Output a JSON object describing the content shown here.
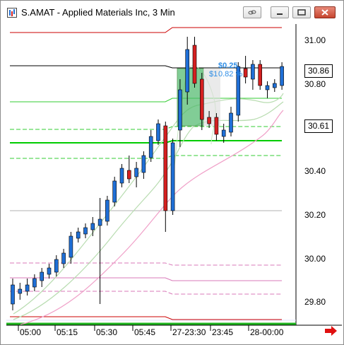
{
  "window": {
    "title": "S.AMAT - Applied Materials Inc, 3 Min",
    "buttons": [
      "link-icon",
      "minimize-icon",
      "restore-icon",
      "close-icon"
    ]
  },
  "price_axis": {
    "ticks": [
      "31.00",
      "30.80",
      "30.40",
      "30.20",
      "30.00",
      "29.80"
    ],
    "last_price": "30.86",
    "marker_price": "30.61"
  },
  "time_axis": {
    "ticks": [
      "05:00",
      "05:15",
      "05:30",
      "05:45",
      "27-23:30",
      "23:45",
      "28-00:00"
    ]
  },
  "annotation": {
    "gain": "$0.25",
    "gain_pct": "0.82 %",
    "prefix": "$1"
  },
  "colors": {
    "up": "#1f6fd6",
    "down": "#d42020",
    "green_line": "#33cc33",
    "pink_line": "#f0a0c8",
    "red_line": "#cc0000"
  },
  "chart_data": {
    "type": "candlestick",
    "ylim": [
      29.7,
      31.1
    ],
    "candles": [
      {
        "o": 29.78,
        "h": 29.9,
        "l": 29.75,
        "c": 29.87
      },
      {
        "o": 29.83,
        "h": 29.88,
        "l": 29.8,
        "c": 29.85
      },
      {
        "o": 29.84,
        "h": 29.9,
        "l": 29.82,
        "c": 29.87
      },
      {
        "o": 29.86,
        "h": 29.92,
        "l": 29.84,
        "c": 29.9
      },
      {
        "o": 29.89,
        "h": 29.95,
        "l": 29.86,
        "c": 29.93
      },
      {
        "o": 29.92,
        "h": 29.97,
        "l": 29.9,
        "c": 29.95
      },
      {
        "o": 29.93,
        "h": 30.01,
        "l": 29.91,
        "c": 29.99
      },
      {
        "o": 29.97,
        "h": 30.04,
        "l": 29.95,
        "c": 30.02
      },
      {
        "o": 30.0,
        "h": 30.12,
        "l": 29.97,
        "c": 30.1
      },
      {
        "o": 30.09,
        "h": 30.14,
        "l": 30.07,
        "c": 30.12
      },
      {
        "o": 30.11,
        "h": 30.16,
        "l": 30.09,
        "c": 30.14
      },
      {
        "o": 30.13,
        "h": 30.19,
        "l": 30.1,
        "c": 30.16
      },
      {
        "o": 30.15,
        "h": 30.28,
        "l": 29.78,
        "c": 30.18
      },
      {
        "o": 30.17,
        "h": 30.29,
        "l": 30.15,
        "c": 30.27
      },
      {
        "o": 30.26,
        "h": 30.38,
        "l": 30.24,
        "c": 30.36
      },
      {
        "o": 30.35,
        "h": 30.44,
        "l": 30.33,
        "c": 30.42
      },
      {
        "o": 30.41,
        "h": 30.48,
        "l": 30.35,
        "c": 30.37
      },
      {
        "o": 30.38,
        "h": 30.45,
        "l": 30.33,
        "c": 30.42
      },
      {
        "o": 30.4,
        "h": 30.5,
        "l": 30.37,
        "c": 30.48
      },
      {
        "o": 30.47,
        "h": 30.6,
        "l": 30.45,
        "c": 30.57
      },
      {
        "o": 30.55,
        "h": 30.65,
        "l": 30.53,
        "c": 30.63
      },
      {
        "o": 30.62,
        "h": 30.64,
        "l": 30.12,
        "c": 30.22
      },
      {
        "o": 30.22,
        "h": 30.56,
        "l": 30.2,
        "c": 30.54
      },
      {
        "o": 30.6,
        "h": 30.84,
        "l": 30.52,
        "c": 30.79
      },
      {
        "o": 30.78,
        "h": 31.04,
        "l": 30.72,
        "c": 30.98
      },
      {
        "o": 31.0,
        "h": 31.04,
        "l": 30.8,
        "c": 30.82
      },
      {
        "o": 30.84,
        "h": 30.87,
        "l": 30.6,
        "c": 30.65
      },
      {
        "o": 30.66,
        "h": 30.69,
        "l": 30.61,
        "c": 30.63
      },
      {
        "o": 30.66,
        "h": 30.68,
        "l": 30.55,
        "c": 30.58
      },
      {
        "o": 30.57,
        "h": 30.63,
        "l": 30.54,
        "c": 30.6
      },
      {
        "o": 30.59,
        "h": 30.71,
        "l": 30.57,
        "c": 30.68
      },
      {
        "o": 30.67,
        "h": 30.92,
        "l": 30.64,
        "c": 30.9
      },
      {
        "o": 30.89,
        "h": 30.95,
        "l": 30.82,
        "c": 30.85
      },
      {
        "o": 30.84,
        "h": 30.93,
        "l": 30.79,
        "c": 30.91
      },
      {
        "o": 30.91,
        "h": 30.93,
        "l": 30.79,
        "c": 30.81
      },
      {
        "o": 30.79,
        "h": 30.83,
        "l": 30.75,
        "c": 30.81
      },
      {
        "o": 30.8,
        "h": 30.84,
        "l": 30.78,
        "c": 30.82
      },
      {
        "o": 30.81,
        "h": 30.92,
        "l": 30.79,
        "c": 30.9
      }
    ]
  }
}
